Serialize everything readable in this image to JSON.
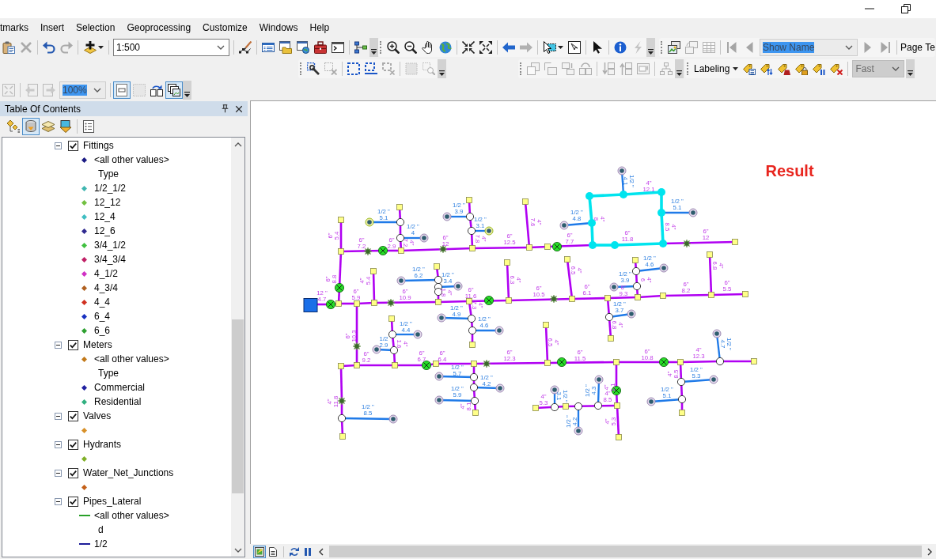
{
  "menu_bar": [
    "tmarks",
    "Insert",
    "Selection",
    "Geoprocessing",
    "Customize",
    "Windows",
    "Help"
  ],
  "toolbar_rows": [
    {
      "toolbars": [
        {
          "items": [
            {
              "kind": "button",
              "disabled": false
            },
            {
              "kind": "button",
              "disabled": true
            },
            {
              "kind": "separator"
            },
            {
              "kind": "button",
              "disabled": false
            },
            {
              "kind": "button",
              "disabled": true
            },
            {
              "kind": "separator"
            },
            {
              "kind": "dropdown_button",
              "disabled": false
            },
            {
              "kind": "separator"
            },
            {
              "kind": "combo",
              "value": "1:500",
              "disabled": false,
              "text_selected": false
            },
            {
              "kind": "separator"
            },
            {
              "kind": "button",
              "disabled": false
            },
            {
              "kind": "separator"
            },
            {
              "kind": "button",
              "disabled": false
            },
            {
              "kind": "button",
              "disabled": false
            },
            {
              "kind": "button",
              "disabled": false
            },
            {
              "kind": "button",
              "disabled": false
            },
            {
              "kind": "button",
              "disabled": false
            },
            {
              "kind": "separator"
            },
            {
              "kind": "button",
              "disabled": false
            },
            {
              "kind": "overflow"
            }
          ]
        },
        {
          "items": [
            {
              "kind": "grip"
            },
            {
              "kind": "button",
              "disabled": false
            },
            {
              "kind": "button",
              "disabled": false
            },
            {
              "kind": "button",
              "disabled": false
            },
            {
              "kind": "button",
              "disabled": false
            },
            {
              "kind": "separator"
            },
            {
              "kind": "button",
              "disabled": false
            },
            {
              "kind": "button",
              "disabled": false
            },
            {
              "kind": "separator"
            },
            {
              "kind": "button",
              "disabled": false
            },
            {
              "kind": "button",
              "disabled": true
            },
            {
              "kind": "separator"
            },
            {
              "kind": "dropdown_button",
              "disabled": false
            },
            {
              "kind": "button",
              "disabled": false
            },
            {
              "kind": "separator"
            },
            {
              "kind": "button",
              "disabled": false
            },
            {
              "kind": "separator"
            },
            {
              "kind": "button",
              "disabled": false
            },
            {
              "kind": "button",
              "disabled": true
            },
            {
              "kind": "overflow"
            }
          ]
        },
        {
          "items": [
            {
              "kind": "grip"
            },
            {
              "kind": "button",
              "disabled": false
            },
            {
              "kind": "button",
              "disabled": true
            },
            {
              "kind": "button",
              "disabled": true
            },
            {
              "kind": "separator"
            },
            {
              "kind": "button",
              "disabled": true
            },
            {
              "kind": "button",
              "disabled": true
            },
            {
              "kind": "combo",
              "value": "Show Name",
              "disabled": true,
              "text_selected": true
            },
            {
              "kind": "button",
              "disabled": true
            },
            {
              "kind": "button",
              "disabled": true
            },
            {
              "kind": "separator"
            },
            {
              "kind": "label",
              "label": "Page Te"
            }
          ]
        }
      ]
    },
    {
      "toolbars": [
        {
          "items": [
            {
              "kind": "grip"
            },
            {
              "kind": "button",
              "disabled": false
            },
            {
              "kind": "button",
              "disabled": true
            },
            {
              "kind": "separator"
            },
            {
              "kind": "button",
              "disabled": false
            },
            {
              "kind": "button",
              "disabled": false
            },
            {
              "kind": "button",
              "disabled": true
            },
            {
              "kind": "separator"
            },
            {
              "kind": "button",
              "disabled": true
            },
            {
              "kind": "button",
              "disabled": true
            },
            {
              "kind": "overflow"
            }
          ]
        },
        {
          "items": [
            {
              "kind": "grip"
            },
            {
              "kind": "button",
              "disabled": true
            },
            {
              "kind": "button",
              "disabled": true
            },
            {
              "kind": "button",
              "disabled": true
            },
            {
              "kind": "button",
              "disabled": true
            },
            {
              "kind": "separator"
            },
            {
              "kind": "button",
              "disabled": true
            },
            {
              "kind": "button",
              "disabled": true
            },
            {
              "kind": "button",
              "disabled": true
            },
            {
              "kind": "separator"
            },
            {
              "kind": "button",
              "disabled": true
            },
            {
              "kind": "overflow"
            }
          ]
        },
        {
          "items": [
            {
              "kind": "grip"
            },
            {
              "kind": "menu",
              "label": "Labeling"
            },
            {
              "kind": "button",
              "disabled": false
            },
            {
              "kind": "button",
              "disabled": false
            },
            {
              "kind": "button",
              "disabled": false
            },
            {
              "kind": "button",
              "disabled": false
            },
            {
              "kind": "button",
              "disabled": false
            },
            {
              "kind": "button",
              "disabled": false
            },
            {
              "kind": "separator"
            },
            {
              "kind": "combo",
              "value": "Fast",
              "disabled": true,
              "text_selected": false
            },
            {
              "kind": "overflow"
            }
          ]
        }
      ]
    },
    {
      "toolbars": [
        {
          "items": [
            {
              "kind": "button",
              "disabled": true,
              "pressed": false
            },
            {
              "kind": "separator"
            },
            {
              "kind": "button",
              "disabled": true,
              "pressed": false
            },
            {
              "kind": "button",
              "disabled": true,
              "pressed": false
            },
            {
              "kind": "combo",
              "value": "100%",
              "disabled": true,
              "text_selected": true
            },
            {
              "kind": "separator"
            },
            {
              "kind": "button",
              "disabled": false,
              "pressed": true
            },
            {
              "kind": "button",
              "disabled": true,
              "pressed": false
            },
            {
              "kind": "button",
              "disabled": false,
              "pressed": false
            },
            {
              "kind": "button",
              "disabled": false,
              "pressed": true
            },
            {
              "kind": "overflow"
            }
          ]
        }
      ]
    }
  ],
  "toc": {
    "title": "Table Of Contents",
    "view_buttons": [
      {
        "selected": false
      },
      {
        "selected": true
      },
      {
        "selected": false
      },
      {
        "selected": false
      }
    ],
    "layers": [
      {
        "name": "Fittings",
        "expanded": true,
        "checked": true,
        "legend": [
          {
            "kind": "point",
            "label": "<all other values>",
            "color": "#1c1c84"
          },
          {
            "kind": "heading",
            "label": "Type"
          },
          {
            "kind": "point",
            "label": "1/2_1/2",
            "color": "#3fb6b0"
          },
          {
            "kind": "point",
            "label": "12_12",
            "color": "#72c040"
          },
          {
            "kind": "point",
            "label": "12_4",
            "color": "#40bec2"
          },
          {
            "kind": "point",
            "label": "12_6",
            "color": "#302a90"
          },
          {
            "kind": "point",
            "label": "3/4_1/2",
            "color": "#40c040"
          },
          {
            "kind": "point",
            "label": "3/4_3/4",
            "color": "#c02066"
          },
          {
            "kind": "point",
            "label": "4_1/2",
            "color": "#d030c4"
          },
          {
            "kind": "point",
            "label": "4_3/4",
            "color": "#b06020"
          },
          {
            "kind": "point",
            "label": "4_4",
            "color": "#d03020"
          },
          {
            "kind": "point",
            "label": "6_4",
            "color": "#1830c0"
          },
          {
            "kind": "point",
            "label": "6_6",
            "color": "#2ea030"
          }
        ]
      },
      {
        "name": "Meters",
        "expanded": true,
        "checked": true,
        "legend": [
          {
            "kind": "point",
            "label": "<all other values>",
            "color": "#c27818"
          },
          {
            "kind": "heading",
            "label": "Type"
          },
          {
            "kind": "point",
            "label": "Commercial",
            "color": "#2020a0"
          },
          {
            "kind": "point",
            "label": "Residential",
            "color": "#30b080"
          }
        ]
      },
      {
        "name": "Valves",
        "expanded": true,
        "checked": true,
        "legend": [
          {
            "kind": "point",
            "color": "#d89028"
          }
        ]
      },
      {
        "name": "Hydrants",
        "expanded": true,
        "checked": true,
        "legend": [
          {
            "kind": "point",
            "color": "#80b028"
          }
        ]
      },
      {
        "name": "Water_Net_Junctions",
        "expanded": true,
        "checked": true,
        "legend": [
          {
            "kind": "point",
            "color": "#c46018"
          }
        ]
      },
      {
        "name": "Pipes_Lateral",
        "expanded": true,
        "checked": true,
        "legend": [
          {
            "kind": "line",
            "label": "<all other values>",
            "color": "#28a028"
          },
          {
            "kind": "heading",
            "label": "d"
          },
          {
            "kind": "line",
            "label": "1/2",
            "color": "#1c1c98"
          }
        ]
      }
    ]
  },
  "map": {
    "title": "Result",
    "pipes": [
      {
        "kind": "main",
        "size": "4\"",
        "length": "12.1",
        "selected": true
      },
      {
        "kind": "lateral",
        "size": "1/2 \"",
        "length": "4.1",
        "selected": false
      },
      {
        "kind": "lateral",
        "size": "1/2 \"",
        "length": "5.1",
        "selected": false
      },
      {
        "kind": "lateral",
        "size": "1/2 \"",
        "length": "3.9",
        "selected": false
      },
      {
        "kind": "main",
        "size": "4\"",
        "length": "7.6",
        "selected": false
      },
      {
        "kind": "lateral",
        "size": "1/2 \"",
        "length": "5.1",
        "selected": false
      },
      {
        "kind": "lateral",
        "size": "1/2 \"",
        "length": "4.8",
        "selected": false
      },
      {
        "kind": "main",
        "size": "4\"",
        "length": "8.5",
        "selected": true
      },
      {
        "kind": "main",
        "size": "4\"",
        "length": "8",
        "selected": true
      },
      {
        "kind": "lateral",
        "size": "1/2 \"",
        "length": "3.1",
        "selected": false
      },
      {
        "kind": "lateral",
        "size": "1/2 \"",
        "length": "4",
        "selected": false
      },
      {
        "kind": "main",
        "size": "6\"",
        "length": "5.4",
        "selected": false
      },
      {
        "kind": "main",
        "size": "4\"",
        "length": "7.2",
        "selected": false
      },
      {
        "kind": "main",
        "size": "4\"",
        "length": "7.8",
        "selected": false
      },
      {
        "kind": "main",
        "size": "6\"",
        "length": "7.2",
        "selected": false
      },
      {
        "kind": "main",
        "size": "6\"",
        "length": "2.9",
        "selected": false
      },
      {
        "kind": "main",
        "size": "6\"",
        "length": "12",
        "selected": false
      },
      {
        "kind": "main",
        "size": "6\"",
        "length": "12.5",
        "selected": false
      },
      {
        "kind": "main",
        "size": "6\"",
        "length": "7.7",
        "selected": false
      },
      {
        "kind": "main",
        "size": "6\"",
        "length": "11.8",
        "selected": true
      },
      {
        "kind": "main",
        "size": "6\"",
        "length": "12",
        "selected": false
      },
      {
        "kind": "lateral",
        "size": "1/2 \"",
        "length": "4.6",
        "selected": false
      },
      {
        "kind": "main",
        "size": "4\"",
        "length": "6.5",
        "selected": false
      },
      {
        "kind": "main",
        "size": "4\"",
        "length": "6.8",
        "selected": false
      },
      {
        "kind": "lateral",
        "size": "1/2 \"",
        "length": "6.2",
        "selected": false
      },
      {
        "kind": "lateral",
        "size": "1/2 \"",
        "length": "3.4",
        "selected": false
      },
      {
        "kind": "lateral",
        "size": "1/2 \"",
        "length": "3.9",
        "selected": false
      },
      {
        "kind": "main",
        "size": "6\"",
        "length": "8.8",
        "selected": false
      },
      {
        "kind": "main",
        "size": "4\"",
        "length": "5.4",
        "selected": false
      },
      {
        "kind": "main",
        "size": "4\"",
        "length": "6.3",
        "selected": false
      },
      {
        "kind": "main",
        "size": "4\"",
        "length": "6",
        "selected": false
      },
      {
        "kind": "main",
        "size": "12 \"",
        "length": "4.7",
        "selected": false
      },
      {
        "kind": "main",
        "size": "6\"",
        "length": "5.9",
        "selected": false
      },
      {
        "kind": "main",
        "size": "6\"",
        "length": "10.9",
        "selected": false
      },
      {
        "kind": "main",
        "size": "4\"",
        "length": "1.8",
        "selected": false
      },
      {
        "kind": "main",
        "size": "6\"",
        "length": "11.6",
        "selected": false
      },
      {
        "kind": "main",
        "size": "6\"",
        "length": "10.5",
        "selected": false
      },
      {
        "kind": "main",
        "size": "6\"",
        "length": "6.1",
        "selected": false
      },
      {
        "kind": "main",
        "size": "6\"",
        "length": "9.3",
        "selected": false
      },
      {
        "kind": "main",
        "size": "6\"",
        "length": "8.2",
        "selected": false
      },
      {
        "kind": "main",
        "size": "6\"",
        "length": "5.5",
        "selected": false
      },
      {
        "kind": "main",
        "size": "4\"",
        "length": "7.3",
        "selected": false
      },
      {
        "kind": "lateral",
        "size": "1/2 \"",
        "length": "3.7",
        "selected": false
      },
      {
        "kind": "lateral",
        "size": "1/2 \"",
        "length": "4.9",
        "selected": false
      },
      {
        "kind": "lateral",
        "size": "1/2 \"",
        "length": "4.6",
        "selected": false
      },
      {
        "kind": "main",
        "size": "4\"",
        "length": "6.8",
        "selected": false
      },
      {
        "kind": "lateral",
        "size": "1/2 \"",
        "length": "4.4",
        "selected": false
      },
      {
        "kind": "main",
        "size": "6\"",
        "length": "10.3",
        "selected": false
      },
      {
        "kind": "lateral",
        "size": "1/2",
        "length": "2.9",
        "selected": false
      },
      {
        "kind": "main",
        "size": "4\"",
        "length": "1.6",
        "selected": false
      },
      {
        "kind": "main",
        "size": "4\"",
        "length": "6.5",
        "selected": false
      },
      {
        "kind": "lateral",
        "size": "1/2 \"",
        "length": "4.7",
        "selected": false
      },
      {
        "kind": "main",
        "size": "6\"",
        "length": "9.2",
        "selected": false
      },
      {
        "kind": "main",
        "size": "6\"",
        "length": "6.7",
        "selected": false
      },
      {
        "kind": "main",
        "size": "6\"",
        "length": "6.4",
        "selected": false
      },
      {
        "kind": "main",
        "size": "6\"",
        "length": "12.3",
        "selected": false
      },
      {
        "kind": "main",
        "size": "6\"",
        "length": "11.5",
        "selected": false
      },
      {
        "kind": "main",
        "size": "6\"",
        "length": "10.8",
        "selected": false
      },
      {
        "kind": "main",
        "size": "4\"",
        "length": "12.3",
        "selected": false
      },
      {
        "kind": "lateral",
        "size": "1/2 \"",
        "length": "5.7",
        "selected": false
      },
      {
        "kind": "lateral",
        "size": "1/2 \"",
        "length": "5.3",
        "selected": false
      },
      {
        "kind": "main",
        "size": "4\"",
        "length": "8.5",
        "selected": false
      },
      {
        "kind": "lateral",
        "size": "1/2 \"",
        "length": "4.2",
        "selected": false
      },
      {
        "kind": "main",
        "size": "4\"",
        "length": "1.1",
        "selected": false
      },
      {
        "kind": "lateral",
        "size": "1/2 \"",
        "length": "4.3",
        "selected": false
      },
      {
        "kind": "lateral",
        "size": "1/2 \"",
        "length": "5.9",
        "selected": false
      },
      {
        "kind": "lateral",
        "size": "1/2 \"",
        "length": "5.1",
        "selected": false
      },
      {
        "kind": "lateral",
        "size": "1/2 \"",
        "length": "3.1",
        "selected": false
      },
      {
        "kind": "main",
        "size": "4\"",
        "length": "5.3",
        "selected": false
      },
      {
        "kind": "main",
        "size": "4\"",
        "length": "8.5",
        "selected": false
      },
      {
        "kind": "main",
        "size": "4\"",
        "length": "11.8",
        "selected": false
      },
      {
        "kind": "lateral",
        "size": "1/2 \"",
        "length": "8.5",
        "selected": false
      },
      {
        "kind": "main",
        "size": "4\"",
        "length": "8.1",
        "selected": false
      },
      {
        "kind": "lateral",
        "size": "1/2 \"",
        "length": "4.2",
        "selected": false
      },
      {
        "kind": "main",
        "size": "4\"",
        "length": "5.3",
        "selected": false
      }
    ]
  },
  "map_bar": {
    "view_buttons": [
      {
        "selected": true
      },
      {
        "selected": false
      }
    ]
  }
}
